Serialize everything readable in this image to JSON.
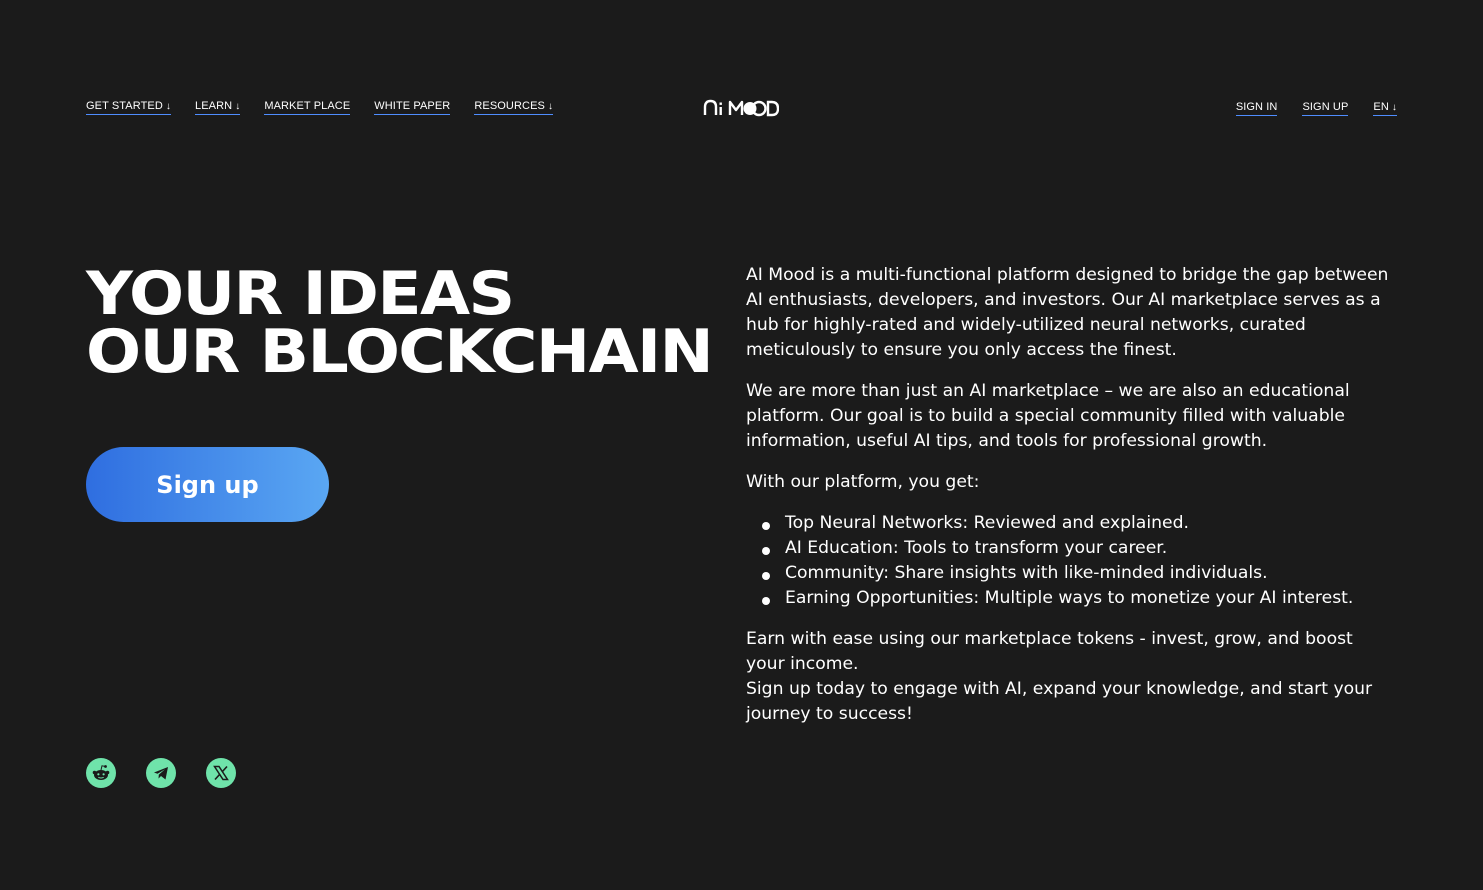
{
  "nav": {
    "left": [
      {
        "label": "GET STARTED",
        "arrow": "↓"
      },
      {
        "label": "LEARN",
        "arrow": "↓"
      },
      {
        "label": "MARKET PLACE",
        "arrow": ""
      },
      {
        "label": "WHITE PAPER",
        "arrow": ""
      },
      {
        "label": "RESOURCES",
        "arrow": "↓"
      }
    ],
    "logo_text": "Ai MOOD",
    "right": [
      {
        "label": "SIGN IN",
        "arrow": ""
      },
      {
        "label": "SIGN UP",
        "arrow": ""
      },
      {
        "label": "EN",
        "arrow": "↓"
      }
    ]
  },
  "hero": {
    "title_line1": "YOUR IDEAS",
    "title_line2": "OUR BLOCKCHAIN",
    "button": "Sign up"
  },
  "socials": [
    {
      "icon": "reddit-icon"
    },
    {
      "icon": "telegram-icon"
    },
    {
      "icon": "x-icon"
    }
  ],
  "content": {
    "p1": "AI Mood is a multi-functional platform designed to bridge the gap between AI enthusiasts, developers, and investors. Our AI marketplace serves as a hub for highly-rated and widely-utilized neural networks, curated meticulously to ensure you only access the finest.",
    "p2": "We are more than just an AI marketplace – we are also an educational platform. Our goal is to build a special community filled with valuable information, useful AI tips, and tools for professional growth.",
    "p3": "With our platform, you get:",
    "bullets": [
      "Top Neural Networks: Reviewed and explained.",
      "AI Education: Tools to transform your career.",
      "Community: Share insights with like-minded individuals.",
      "Earning Opportunities: Multiple ways to monetize your AI interest."
    ],
    "p4": "Earn with ease using our marketplace tokens - invest, grow, and boost your income.",
    "p5": "Sign up today to engage with AI, expand your knowledge, and start your journey to success!"
  },
  "colors": {
    "background": "#1b1b1b",
    "accent": "#4f8dff",
    "button_start": "#2f6ee0",
    "button_end": "#5aa7f3",
    "social_bg": "#6fe3aa"
  }
}
